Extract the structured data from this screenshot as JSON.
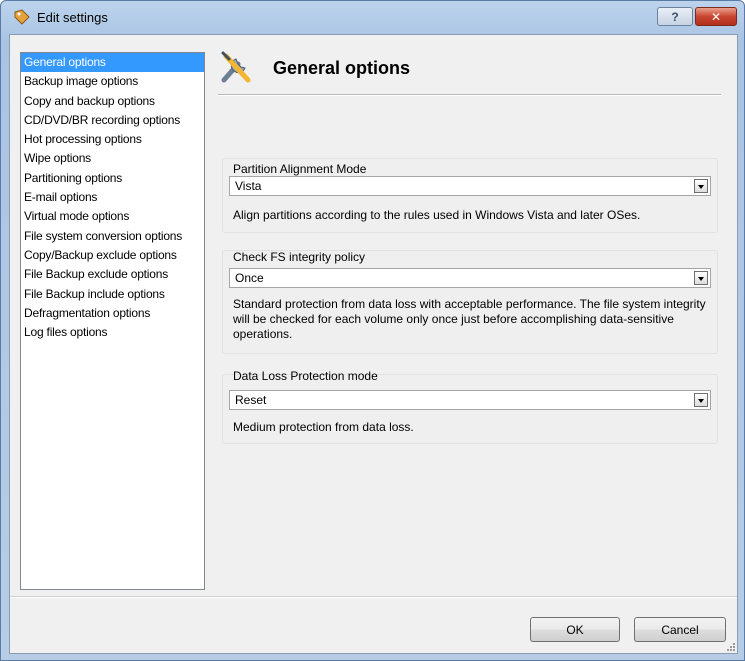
{
  "window": {
    "title": "Edit settings",
    "help_label": "?",
    "close_label": "✕"
  },
  "nav": {
    "items": [
      {
        "label": "General options",
        "selected": true
      },
      {
        "label": "Backup image options"
      },
      {
        "label": "Copy and backup options"
      },
      {
        "label": "CD/DVD/BR recording options"
      },
      {
        "label": "Hot processing options"
      },
      {
        "label": "Wipe options"
      },
      {
        "label": "Partitioning options"
      },
      {
        "label": "E-mail options"
      },
      {
        "label": "Virtual mode options"
      },
      {
        "label": "File system conversion options"
      },
      {
        "label": "Copy/Backup exclude options"
      },
      {
        "label": "File Backup exclude options"
      },
      {
        "label": "File Backup include options"
      },
      {
        "label": "Defragmentation options"
      },
      {
        "label": "Log files options"
      }
    ]
  },
  "page": {
    "title": "General options",
    "icon": "tools-icon"
  },
  "groups": {
    "alignment": {
      "label": "Partition Alignment Mode",
      "value": "Vista",
      "description": "Align partitions according to the rules used in Windows Vista and later OSes."
    },
    "fs_integrity": {
      "label": "Check FS integrity policy",
      "value": "Once",
      "description": "Standard protection from data loss with acceptable performance. The file system integrity will be checked for each volume only once just before accomplishing data-sensitive operations."
    },
    "data_loss": {
      "label": "Data Loss Protection mode",
      "value": "Reset",
      "description": "Medium protection from data loss."
    }
  },
  "buttons": {
    "ok": "OK",
    "cancel": "Cancel"
  }
}
